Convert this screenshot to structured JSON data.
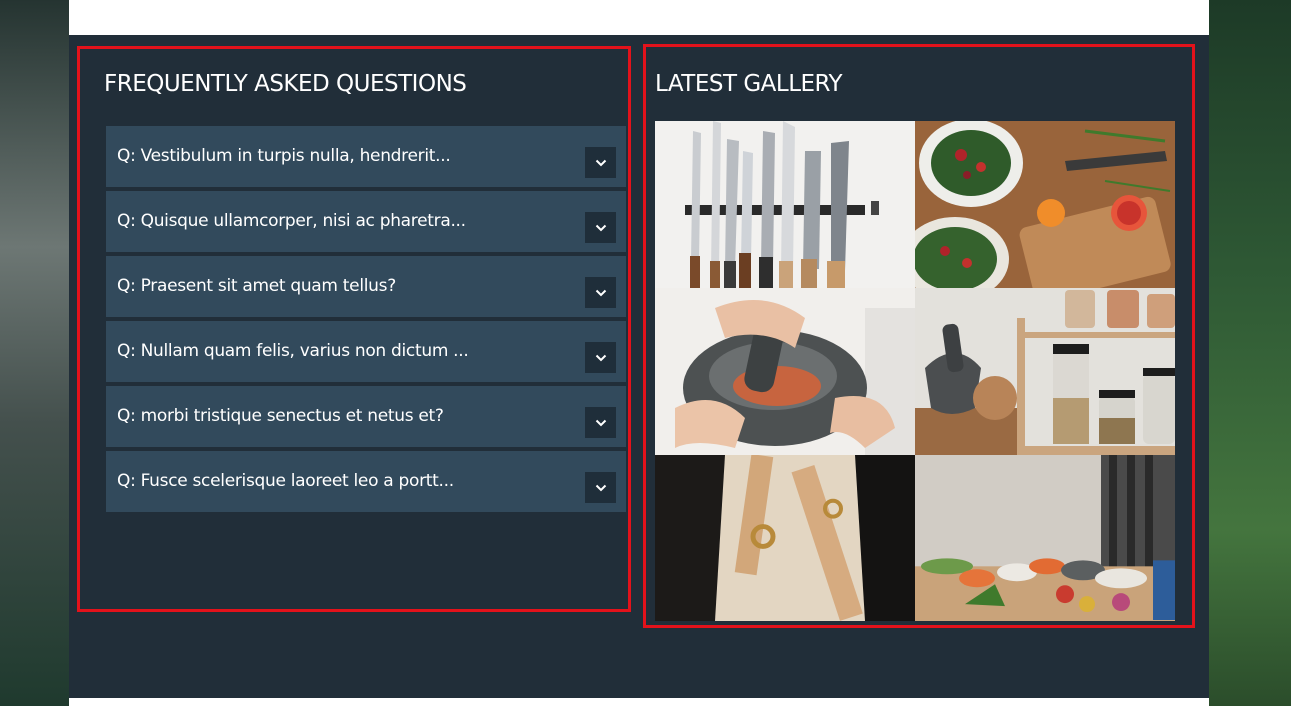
{
  "faq": {
    "title": "FREQUENTLY ASKED QUESTIONS",
    "items": [
      {
        "question": "Q: Vestibulum in turpis nulla, hendrerit..."
      },
      {
        "question": "Q: Quisque ullamcorper, nisi ac pharetra..."
      },
      {
        "question": "Q: Praesent sit amet quam tellus?"
      },
      {
        "question": "Q: Nullam quam felis, varius non dictum ..."
      },
      {
        "question": "Q: morbi tristique senectus et netus et?"
      },
      {
        "question": "Q: Fusce scelerisque laoreet leo a portt..."
      }
    ],
    "toggle_icon": "chevron-down-icon"
  },
  "gallery": {
    "title": "LATEST GALLERY",
    "images": [
      {
        "subject": "knives-on-magnetic-rack"
      },
      {
        "subject": "salad-bowls-and-blood-oranges"
      },
      {
        "subject": "mortar-and-pestle-hands"
      },
      {
        "subject": "spice-jars-on-shelf"
      },
      {
        "subject": "leather-apron-strap"
      },
      {
        "subject": "kitchen-counter-ingredients"
      }
    ]
  },
  "colors": {
    "panel_bg": "#212e39",
    "faq_item_bg": "#324a5c",
    "toggle_bg": "#1f2e3a",
    "highlight_border": "#e3121b"
  }
}
